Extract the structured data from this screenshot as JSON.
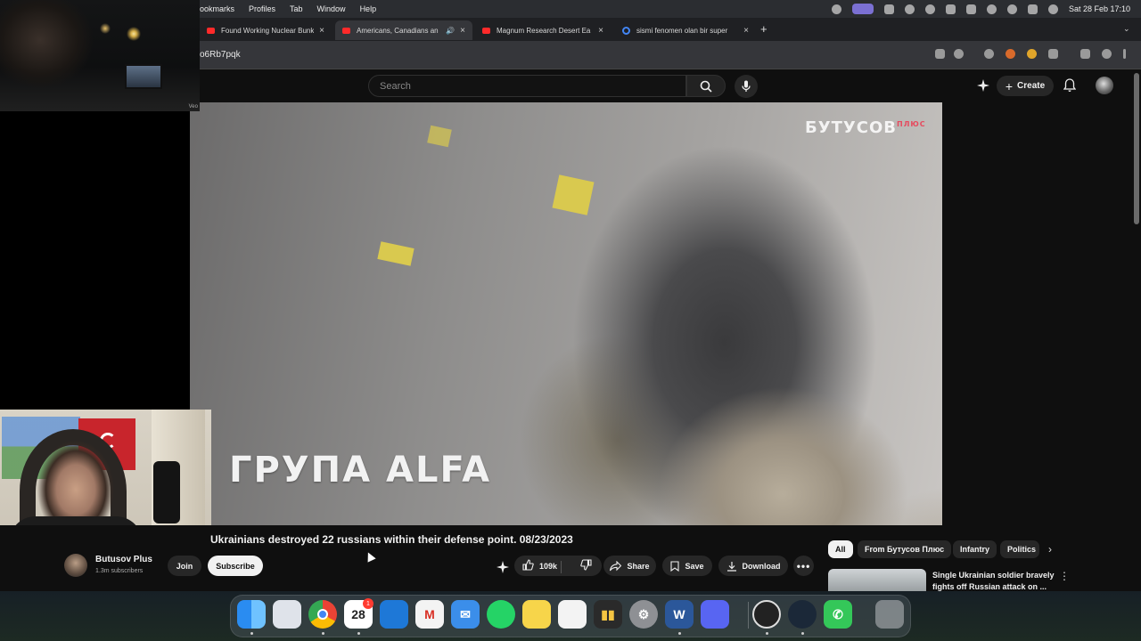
{
  "menubar": {
    "menus": [
      "ookmarks",
      "Profiles",
      "Tab",
      "Window",
      "Help"
    ],
    "clock": "Sat 28 Feb  17:10"
  },
  "tabs": [
    {
      "title": "Found Working Nuclear Bunk",
      "favicon": "youtube-icon",
      "active": false
    },
    {
      "title": "Americans, Canadians an",
      "favicon": "youtube-icon",
      "active": true,
      "audio": true
    },
    {
      "title": "Magnum Research Desert Ea",
      "favicon": "youtube-icon",
      "active": false
    },
    {
      "title": "sismi fenomen olan bir super",
      "favicon": "google-icon",
      "active": false
    }
  ],
  "address": {
    "url": "o6Rb7pqk"
  },
  "youtube": {
    "search_placeholder": "Search",
    "create_label": "Create"
  },
  "video": {
    "watermark": "БУТУСОВ",
    "watermark_sup": "ПЛЮС",
    "overlay_text": "ГРУПА ALFA",
    "title": "Ukrainians destroyed 22 russians within their defense point. 08/23/2023",
    "channel": "Butusov Plus",
    "subscribers": "1.3m subscribers",
    "join_label": "Join",
    "subscribe_label": "Subscribe",
    "likes": "109k",
    "share_label": "Share",
    "save_label": "Save",
    "download_label": "Download"
  },
  "cam_label": "Veo",
  "chips": [
    "All",
    "From Бутусов Плюс",
    "Infantry",
    "Politics"
  ],
  "recommendation": {
    "title": "Single Ukrainian soldier bravely fights off Russian attack on ..."
  },
  "dock": {
    "calendar_day": "28",
    "calendar_badge": "1",
    "apps": [
      "finder-icon",
      "launchpad-icon",
      "chrome-icon",
      "calendar-icon",
      "outlook-icon",
      "gmail-icon",
      "mail-icon",
      "whatsapp-icon",
      "notes-icon",
      "reminders-icon",
      "stocks-icon",
      "settings-icon",
      "word-icon",
      "discord-icon",
      "obs-icon",
      "steam-icon",
      "phone-icon",
      "trash-icon"
    ]
  },
  "colors": {
    "accent_red": "#ff0000",
    "youtube_bg": "#0f0f0f",
    "chip_bg": "#272727"
  }
}
